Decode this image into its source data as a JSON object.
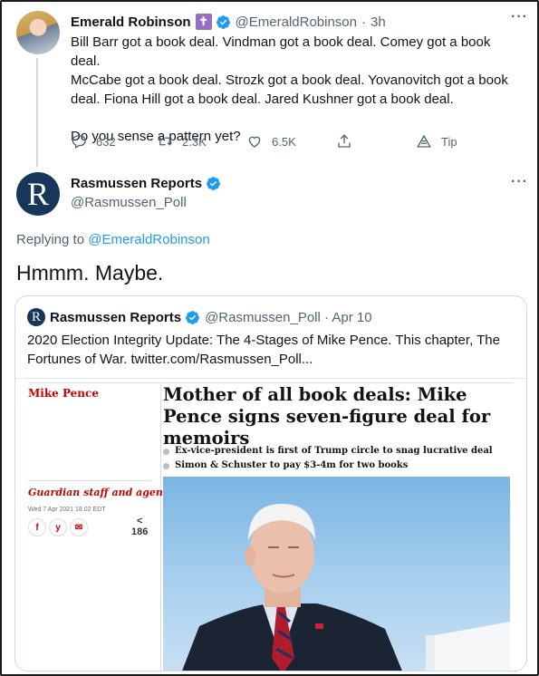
{
  "tweet": {
    "author_name": "Emerald Robinson",
    "badge_glyph": "✝",
    "handle": "@EmeraldRobinson",
    "time": "3h",
    "lines": [
      "Bill Barr got a book deal. Vindman got a book deal. Comey got a book deal.",
      "McCabe got a book deal. Strozk got a book deal. Yovanovitch got a book",
      "deal. Fiona Hill got a book deal. Jared Kushner got a book deal."
    ],
    "question": "Do you sense a pattern yet?",
    "actions": {
      "replies": "632",
      "retweets": "2.3K",
      "likes": "6.5K",
      "tip": "Tip"
    }
  },
  "reply": {
    "author_name": "Rasmussen Reports",
    "handle": "@Rasmussen_Poll",
    "avatar_letter": "R",
    "replying_prefix": "Replying to",
    "replying_to": "@EmeraldRobinson",
    "text": "Hmmm. Maybe."
  },
  "quote": {
    "avatar_letter": "R",
    "author_name": "Rasmussen Reports",
    "handle_time": "@Rasmussen_Poll · Apr 10",
    "line1": "2020 Election Integrity Update: The 4-Stages of Mike Pence. This chapter, The",
    "line2": "Fortunes of War.  twitter.com/Rasmussen_Poll..."
  },
  "article": {
    "tag": "Mike Pence",
    "headline": "Mother of all book deals: Mike Pence signs seven-figure deal for memoirs",
    "bullets": [
      "Ex-vice-president is first of Trump circle to snag lucrative deal",
      "Simon & Schuster to pay $3-4m for two books"
    ],
    "author": "Guardian staff and agencies",
    "date": "Wed 7 Apr 2021 18.02 EDT",
    "share_icons": [
      "f",
      "y",
      "✉"
    ],
    "share_arrow": "<",
    "share_count": "186"
  },
  "colors": {
    "accent": "#1d9bf0",
    "muted": "#536471",
    "guardian_red": "#c70000",
    "rasmussen_navy": "#17365a"
  },
  "icons": [
    "reply-icon",
    "retweet-icon",
    "like-icon",
    "share-icon",
    "tip-icon",
    "verified-icon",
    "more-icon"
  ]
}
